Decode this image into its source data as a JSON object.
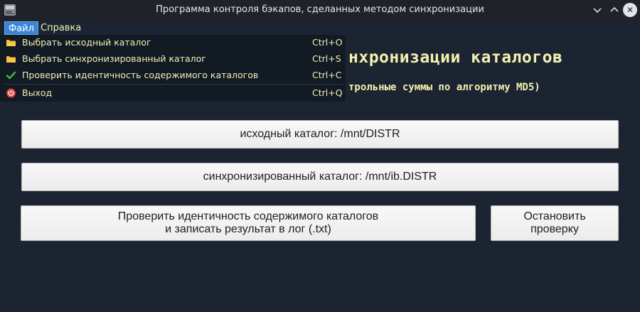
{
  "window": {
    "title": "Программа контроля бэкапов, сделанных методом синхронизации",
    "minimize_glyph": "⌄",
    "maximize_glyph": "⌃",
    "close_glyph": "✕"
  },
  "menubar": {
    "file": "Файл",
    "help": "Справка"
  },
  "file_menu": {
    "items": [
      {
        "label": "Выбрать исходный каталог",
        "shortcut": "Ctrl+O",
        "icon": "folder-icon"
      },
      {
        "label": "Выбрать синхронизированный каталог",
        "shortcut": "Ctrl+S",
        "icon": "folder-icon"
      },
      {
        "label": "Проверить идентичность содержимого каталогов",
        "shortcut": "Ctrl+C",
        "icon": "checkmark-icon"
      },
      {
        "label": "Выход",
        "shortcut": "Ctrl+Q",
        "icon": "power-icon"
      }
    ]
  },
  "main": {
    "title_partial": "нхронизации каталогов",
    "subtitle_partial": "трольные суммы по алгоритму MD5)",
    "source_button": "исходный каталог: /mnt/DISTR",
    "sync_button": "синхронизированный каталог: /mnt/ib.DISTR",
    "check_button_line1": "Проверить идентичность содержимого каталогов",
    "check_button_line2": "и записать результат в лог (.txt)",
    "stop_button_line1": "Остановить",
    "stop_button_line2": "проверку"
  },
  "colors": {
    "background": "#1b2430",
    "menu_text": "#f2efb8",
    "menu_highlight": "#3a85d6",
    "titlebar": "#1f2329"
  }
}
